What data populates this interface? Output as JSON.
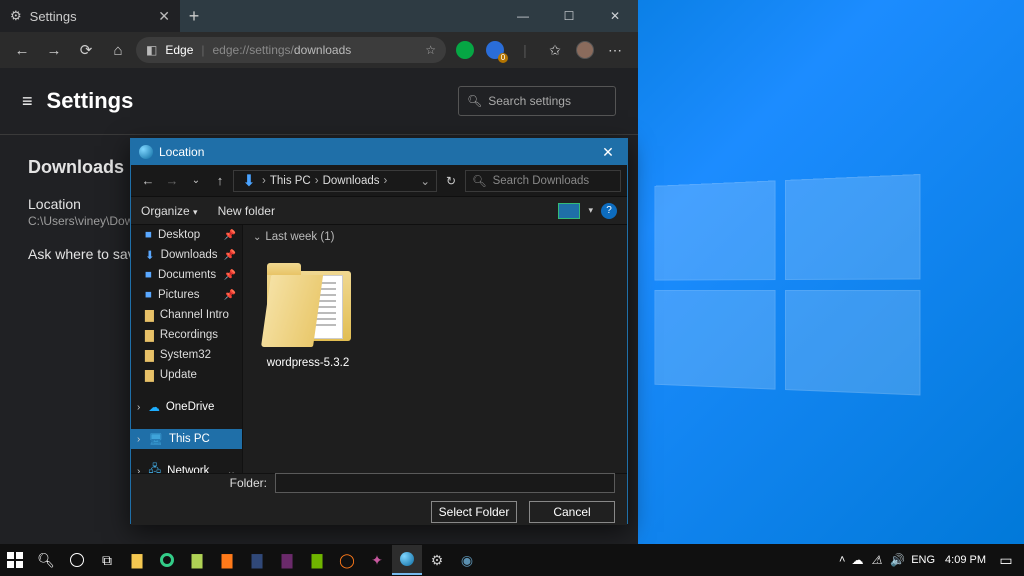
{
  "desktop": {
    "time": "4:09 PM",
    "lang": "ENG"
  },
  "edge": {
    "tab_title": "Settings",
    "addr_prefix": "Edge",
    "addr_dim": "edge://settings/",
    "addr_active": "downloads",
    "search_placeholder": "Search settings",
    "settings_title": "Settings",
    "section_title": "Downloads",
    "location_label": "Location",
    "location_value": "C:\\Users\\viney\\Down",
    "ask_label": "Ask where to sav"
  },
  "dialog": {
    "title": "Location",
    "crumb1": "This PC",
    "crumb2": "Downloads",
    "search_placeholder": "Search Downloads",
    "organize": "Organize",
    "newfolder": "New folder",
    "side": {
      "desktop": "Desktop",
      "downloads": "Downloads",
      "documents": "Documents",
      "pictures": "Pictures",
      "channel": "Channel Intro",
      "recordings": "Recordings",
      "system32": "System32",
      "update": "Update",
      "onedrive": "OneDrive",
      "thispc": "This PC",
      "network": "Network"
    },
    "group": "Last week (1)",
    "item_name": "wordpress-5.3.2",
    "folder_label": "Folder:",
    "select_btn": "Select Folder",
    "cancel_btn": "Cancel"
  }
}
